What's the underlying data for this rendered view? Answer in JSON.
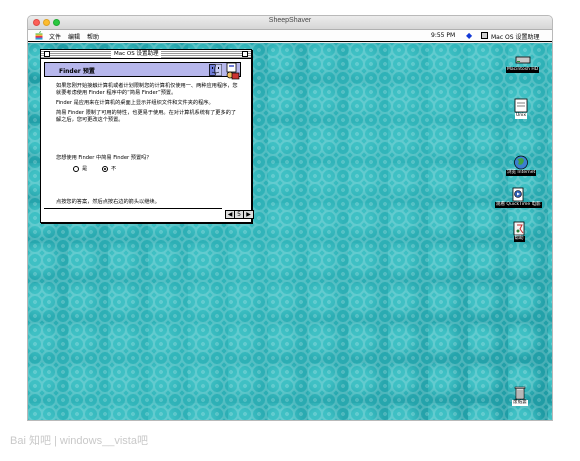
{
  "host_window": {
    "title": "SheepShaver"
  },
  "menubar": {
    "file": "文件",
    "edit": "编辑",
    "help": "帮助",
    "clock": "9:55 PM",
    "app_name": "Mac OS 设置助理"
  },
  "dialog": {
    "title": "Mac OS 设置助理",
    "heading": "Finder 预置",
    "paragraphs": [
      "如果您刚开始接触计算机或者计划限制您的计算机仅使用一、两种应用程序，您就要考虑使用 Finder 程序中的“简易 Finder”预置。",
      "Finder 是应用来在计算机的桌面上显示并组织文件和文件夹的程序。",
      "简易 Finder 限制了可用的特性，也更易于使用。在对计算机系统有了更多的了解之后，您可更改这个预置。"
    ],
    "question": "您想使用 Finder 中简易 Finder 预置吗？",
    "options": {
      "yes": "是",
      "no": "不"
    },
    "selected": "no",
    "footer": "点按您的答案，然后点按右边的箭头以继续。",
    "nav": {
      "prev": "◀",
      "page": "5",
      "next": "▶"
    }
  },
  "desktop_icons": {
    "hard_disk": "Macintosh HD",
    "unix": "Unix",
    "internet": "浏览 Internet",
    "quicktime": "观看 QuickTime 电影",
    "help": "帮助",
    "trash": "废纸篓"
  },
  "watermark": "Bai 知吧 | windows__vista吧",
  "colors": {
    "desktop": "#2aa7ac",
    "dialog_banner": "#b7b7ec",
    "menu_diamond": "#1238d6"
  }
}
